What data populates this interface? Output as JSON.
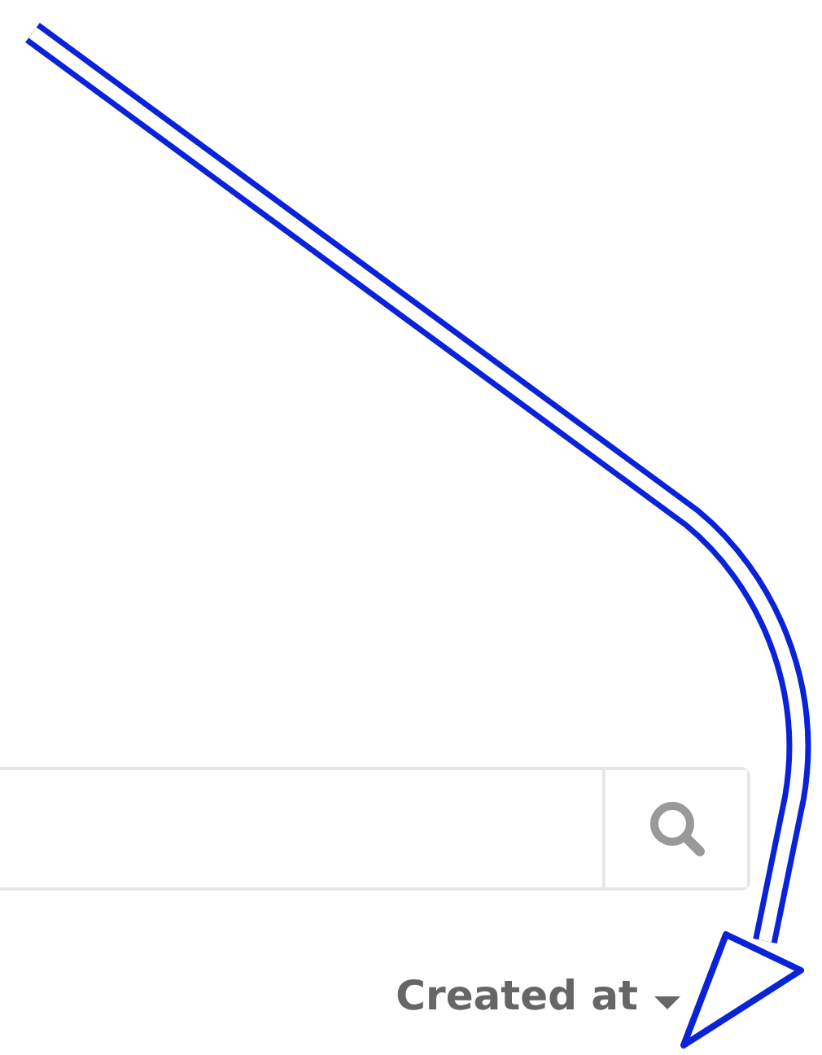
{
  "sort_header": {
    "label": "Created at"
  }
}
